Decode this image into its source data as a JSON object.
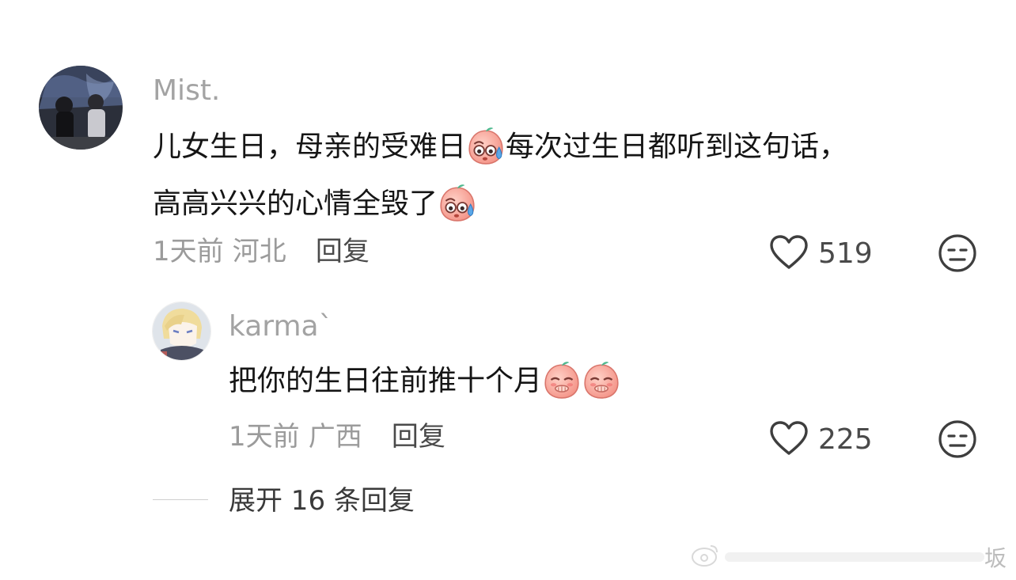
{
  "comment": {
    "username": "Mist.",
    "text_part1": "儿女生日，母亲的受难日",
    "text_part2": "每次过生日都听到这句话，",
    "text_part3": "高高兴兴的心情全毁了",
    "time": "1天前",
    "location": "河北",
    "reply_label": "回复",
    "likes": "519"
  },
  "reply": {
    "username": "karma`",
    "text": "把你的生日往前推十个月",
    "time": "1天前",
    "location": "广西",
    "reply_label": "回复",
    "likes": "225"
  },
  "expand_label": "展开 16 条回复",
  "watermark": "坂",
  "icons": {
    "like": "heart-outline-icon",
    "dislike": "meh-face-icon",
    "emoji_sweat": "peach-sweat-emoji",
    "emoji_cover_mouth": "peach-cover-mouth-emoji"
  },
  "colors": {
    "username": "#a3a3a3",
    "text": "#151515",
    "meta": "#9b9b9b"
  }
}
